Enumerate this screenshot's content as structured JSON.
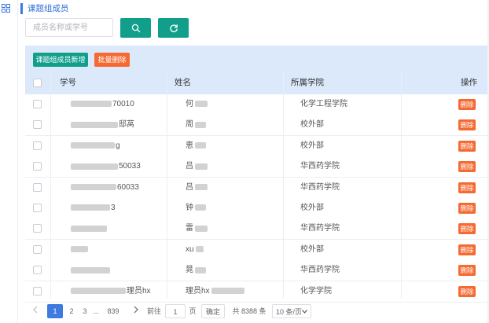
{
  "section_title": "课题组成员",
  "search": {
    "placeholder": "成员名称或学号"
  },
  "toolbar": {
    "add_label": "课题组成员新增",
    "batch_delete_label": "批量删除"
  },
  "table": {
    "headers": {
      "id": "学号",
      "name": "姓名",
      "college": "所属学院",
      "action": "操作"
    },
    "delete_label": "删除",
    "rows": [
      {
        "id_visible": "70010",
        "name_visible": "何",
        "college": "化学工程学院"
      },
      {
        "id_visible": "邸莴",
        "name_visible": "周",
        "college": "校外部"
      },
      {
        "id_visible": "g",
        "name_visible": "恵",
        "college": "校外部"
      },
      {
        "id_visible": "50033",
        "name_visible": "吕",
        "college": "华西药学院"
      },
      {
        "id_visible": "60033",
        "name_visible": "吕",
        "college": "华西药学院"
      },
      {
        "id_visible": "3",
        "name_visible": "钟",
        "college": "校外部"
      },
      {
        "id_visible": "",
        "name_visible": "雷",
        "college": "华西药学院"
      },
      {
        "id_visible": "",
        "name_visible": "xu",
        "college": "校外部"
      },
      {
        "id_visible": "",
        "name_visible": "晁",
        "college": "华西药学院"
      },
      {
        "id_visible": "理员hx",
        "name_visible": "理员hx",
        "college": "化学学院"
      }
    ]
  },
  "pagination": {
    "pages": [
      "1",
      "2",
      "3",
      "...",
      "839"
    ],
    "goto_label": "前往",
    "goto_value": "1",
    "page_unit": "页",
    "confirm_label": "确定",
    "total_text": "共 8388 条",
    "page_size": "10 条/页"
  },
  "colors": {
    "primary": "#119f8c",
    "danger": "#f56a32",
    "accent": "#3d7be0",
    "header_bg": "#dbe9fa"
  }
}
